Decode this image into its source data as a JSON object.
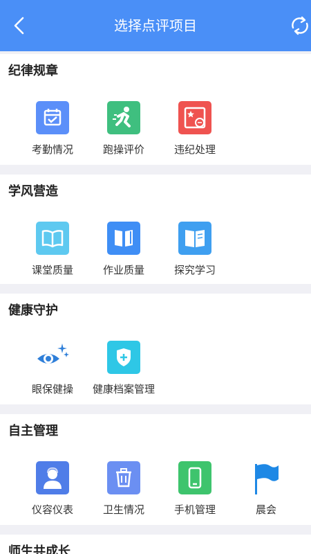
{
  "header": {
    "title": "选择点评项目",
    "back_icon": "back-arrow-icon",
    "refresh_icon": "refresh-icon",
    "background": "#4a8ff7"
  },
  "sections": [
    {
      "title": "纪律规章",
      "items": [
        {
          "label": "考勤情况",
          "icon": "calendar-check-icon",
          "color": "#5b8ff9"
        },
        {
          "label": "跑操评价",
          "icon": "running-icon",
          "color": "#3fbf7f"
        },
        {
          "label": "违纪处理",
          "icon": "penalty-icon",
          "color": "#ef5350"
        }
      ]
    },
    {
      "title": "学风营造",
      "items": [
        {
          "label": "课堂质量",
          "icon": "open-book-icon",
          "color": "#5ec9f0"
        },
        {
          "label": "作业质量",
          "icon": "notebook-icon",
          "color": "#3f8ef5"
        },
        {
          "label": "探究学习",
          "icon": "book-icon",
          "color": "#3f9ff0"
        }
      ]
    },
    {
      "title": "健康守护",
      "items": [
        {
          "label": "眼保健操",
          "icon": "eye-icon",
          "color": "#2f7fd9"
        },
        {
          "label": "健康档案管理",
          "icon": "medical-shield-icon",
          "color": "#2ec7e6"
        }
      ]
    },
    {
      "title": "自主管理",
      "items": [
        {
          "label": "仪容仪表",
          "icon": "person-icon",
          "color": "#4f7de8"
        },
        {
          "label": "卫生情况",
          "icon": "trash-icon",
          "color": "#6b8ff2"
        },
        {
          "label": "手机管理",
          "icon": "phone-icon",
          "color": "#3ec46d"
        },
        {
          "label": "晨会",
          "icon": "flag-icon",
          "color": "#1e88e5"
        }
      ]
    },
    {
      "title": "师生共成长",
      "items": []
    }
  ]
}
